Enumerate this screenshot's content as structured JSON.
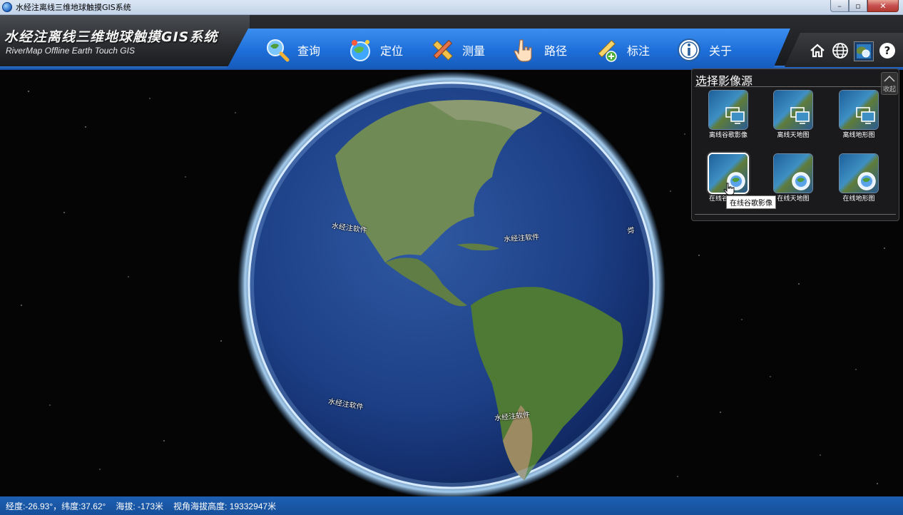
{
  "window": {
    "title": "水经注离线三维地球触摸GIS系统",
    "min_label": "–",
    "max_label": "▫",
    "close_label": "✕"
  },
  "brand": {
    "title": "水经注离线三维地球触摸GIS系统",
    "subtitle": "RiverMap Offline Earth Touch GIS"
  },
  "nav": {
    "items": [
      {
        "label": "查询",
        "icon": "magnifier-globe-icon"
      },
      {
        "label": "定位",
        "icon": "locate-globe-icon"
      },
      {
        "label": "测量",
        "icon": "ruler-pencil-icon"
      },
      {
        "label": "路径",
        "icon": "hand-pointer-icon"
      },
      {
        "label": "标注",
        "icon": "pencil-add-icon"
      },
      {
        "label": "关于",
        "icon": "info-icon"
      }
    ]
  },
  "toolbar": {
    "home": "home-icon",
    "globe": "globe-icon",
    "layers": "imagery-layer-icon",
    "help": "help-icon"
  },
  "globe": {
    "labels": [
      "水经注软件",
      "水经注软件",
      "水经注软件",
      "水经注软件",
      "软"
    ]
  },
  "source_panel": {
    "title": "选择影像源",
    "collapse_label": "收起",
    "tiles": [
      {
        "label": "离线谷歌影像",
        "kind": "offline"
      },
      {
        "label": "离线天地图",
        "kind": "offline"
      },
      {
        "label": "离线地形图",
        "kind": "offline"
      },
      {
        "label": "在线谷歌影像",
        "kind": "online",
        "selected": true
      },
      {
        "label": "在线天地图",
        "kind": "online"
      },
      {
        "label": "在线地形图",
        "kind": "online"
      }
    ],
    "tooltip": "在线谷歌影像"
  },
  "status": {
    "longitude": "经度:-26.93°，",
    "latitude": "纬度:37.62°",
    "elevation": "海拔: -173米",
    "view_height": "视角海拔高度: 19332947米"
  },
  "colors": {
    "nav_blue": "#1e6fd9",
    "status_blue": "#1d5fb2"
  }
}
